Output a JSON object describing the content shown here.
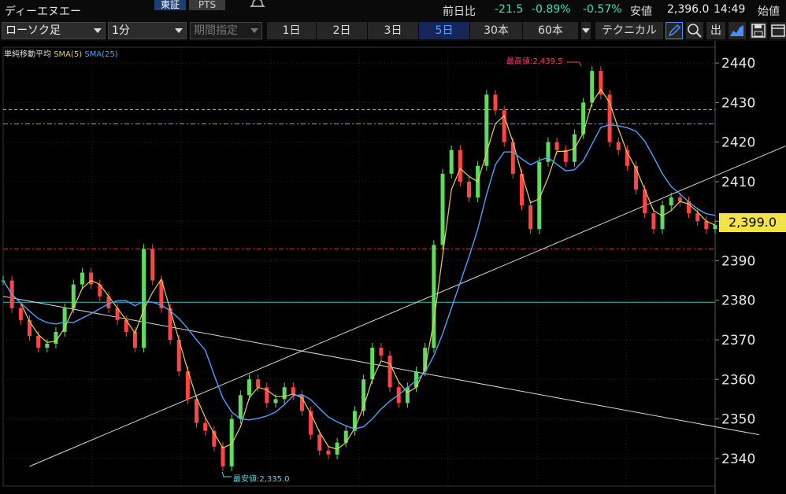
{
  "header": {
    "title": "ディーエヌエー",
    "market_tabs": [
      "東証",
      "PTS"
    ],
    "change_label": "前日比",
    "change_value": "-21.5",
    "change_pct": "-0.89%",
    "change_pct2": "-0.57%",
    "low_label": "安値",
    "low_value": "2,396.0",
    "time": "14:49",
    "open_label": "始値"
  },
  "toolbar": {
    "chart_type": "ローソク足",
    "interval": "1分",
    "period_placeholder": "期間指定",
    "ranges": [
      "1日",
      "2日",
      "3日",
      "5日",
      "30本",
      "60本"
    ],
    "selected_range": "5日",
    "technical_label": "テクニカル",
    "out_label": "出"
  },
  "legend": {
    "title": "単純移動平均",
    "sma5": "SMA(5)",
    "sma25": "SMA(25)"
  },
  "colors": {
    "up": "#5fdc5f",
    "down": "#ff4444",
    "sma5": "#e8d04a",
    "sma25": "#4aa0ff",
    "price_tag": "#f2e34a",
    "high_label": "#ff3b6b",
    "low_label": "#5ad6e0"
  },
  "icons": [
    "pen-icon",
    "zoom-icon",
    "area-chart-icon",
    "save-icon",
    "window-icon",
    "bell-icon"
  ],
  "chart_data": {
    "type": "line",
    "series": [
      {
        "values": [
          2385,
          2378,
          2375,
          2371,
          2368,
          2369,
          2372,
          2378,
          2384,
          2387,
          2384,
          2381,
          2378,
          2375,
          2372,
          2368,
          2393,
          2385,
          2378,
          2370,
          2362,
          2355,
          2349,
          2347,
          2343,
          2338,
          2350,
          2356,
          2360,
          2358,
          2354,
          2355,
          2358,
          2356,
          2352,
          2346,
          2342,
          2341,
          2344,
          2347,
          2352,
          2360,
          2368,
          2366,
          2358,
          2354,
          2358,
          2362,
          2368,
          2394,
          2412,
          2418,
          2410,
          2406,
          2414,
          2432,
          2428,
          2420,
          2412,
          2404,
          2398,
          2415,
          2420,
          2418,
          2415,
          2422,
          2430,
          2438,
          2432,
          2420,
          2418,
          2414,
          2408,
          2402,
          2398,
          2404,
          2406,
          2405,
          2402,
          2400,
          2398,
          2399
        ]
      }
    ],
    "y_ticks": [
      "2440",
      "2430",
      "2420",
      "2410",
      "2400",
      "2390",
      "2380",
      "2370",
      "2360",
      "2350",
      "2340"
    ],
    "ylim": [
      2333,
      2444
    ],
    "high_label": "最高値:2,439.5",
    "low_label": "最安値:2,335.0",
    "last_price": "2,399.0",
    "h_lines": [
      {
        "value": 2428.2,
        "color": "#e8d04a",
        "dash": "4,3"
      },
      {
        "value": 2424.6,
        "color": "#3ac0c0",
        "dash": "6,3,2,3"
      },
      {
        "value": 2393.0,
        "color": "#c03050",
        "dash": "6,3,2,3"
      },
      {
        "value": 2379.5,
        "color": "#3ac0c0",
        "dash": ""
      }
    ],
    "trend_lines": [
      {
        "from": [
          0,
          2381
        ],
        "to": [
          86,
          2346
        ]
      },
      {
        "from": [
          3,
          2338
        ],
        "to": [
          89,
          2419
        ]
      }
    ]
  }
}
